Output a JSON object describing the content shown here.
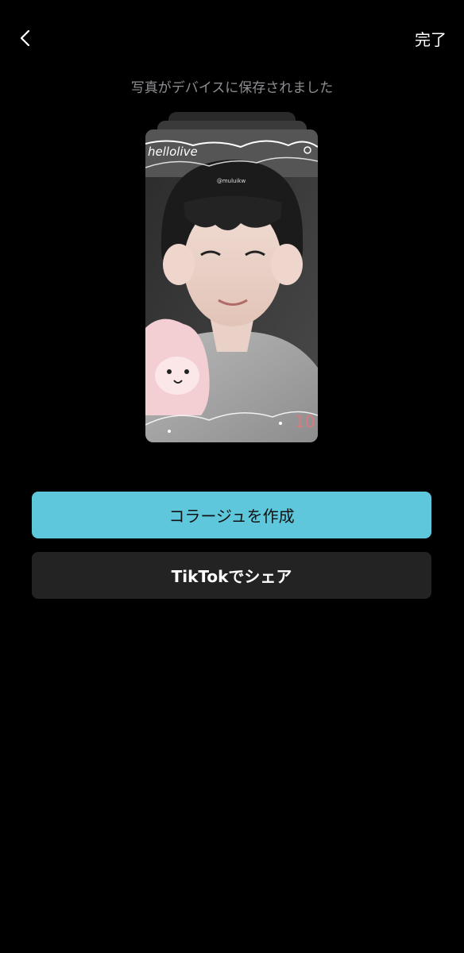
{
  "header": {
    "done_label": "完了"
  },
  "status": {
    "message": "写真がデバイスに保存されました"
  },
  "photo": {
    "sticker_brand": "hellolive",
    "username": "@muluikw",
    "sticker_number": "10"
  },
  "actions": {
    "collage_label": "コラージュを作成",
    "share_label": "TikTokでシェア"
  },
  "colors": {
    "background": "#000000",
    "primary_button": "#5ec7dc",
    "secondary_button": "#232323",
    "status_text": "#8e8e93"
  }
}
